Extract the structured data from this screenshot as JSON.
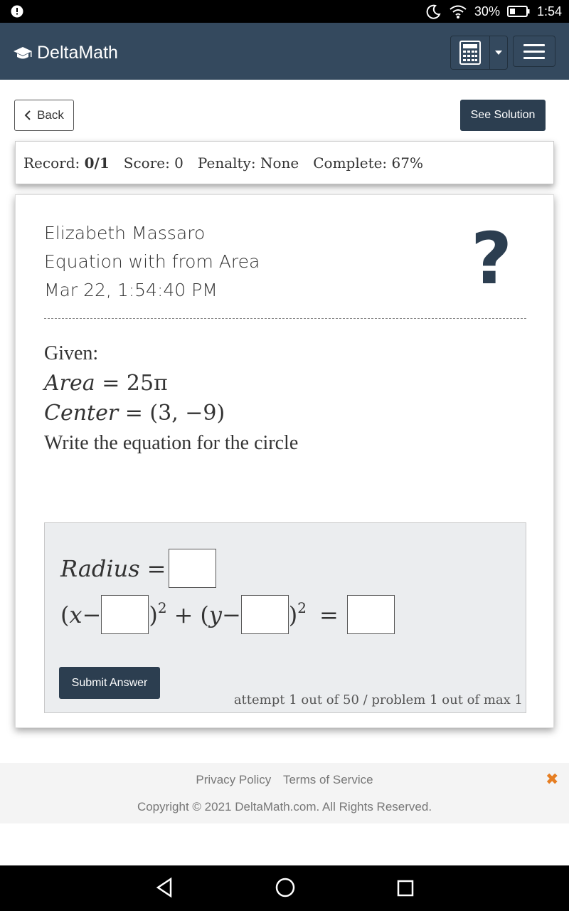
{
  "status_bar": {
    "battery": "30%",
    "time": "1:54"
  },
  "header": {
    "brand": "DeltaMath"
  },
  "actions": {
    "back_label": "Back",
    "solution_label": "See Solution"
  },
  "record": {
    "record_label": "Record:",
    "record_value": "0/1",
    "score": "Score: 0",
    "penalty": "Penalty: None",
    "complete": "Complete: 67%"
  },
  "assignment": {
    "student": "Elizabeth Massaro",
    "topic": "Equation with from Area",
    "timestamp": "Mar 22, 1:54:40 PM",
    "help_symbol": "?"
  },
  "problem": {
    "given": "Given:",
    "area_var": "Area",
    "area_val": "= 25π",
    "center_var": "Center",
    "center_val": "= (3, −9)",
    "instruction": "Write the equation for the circle"
  },
  "answer": {
    "radius_label": "Radius",
    "submit_label": "Submit Answer",
    "attempt_text": "attempt 1 out of 50 / problem 1 out of max 1"
  },
  "footer": {
    "privacy": "Privacy Policy",
    "terms": "Terms of Service",
    "copyright": "Copyright © 2021 DeltaMath.com. All Rights Reserved.",
    "close_symbol": "✖"
  },
  "colors": {
    "header_bg": "#34495e",
    "button_dark": "#2c3e50",
    "close_accent": "#e67e22"
  }
}
